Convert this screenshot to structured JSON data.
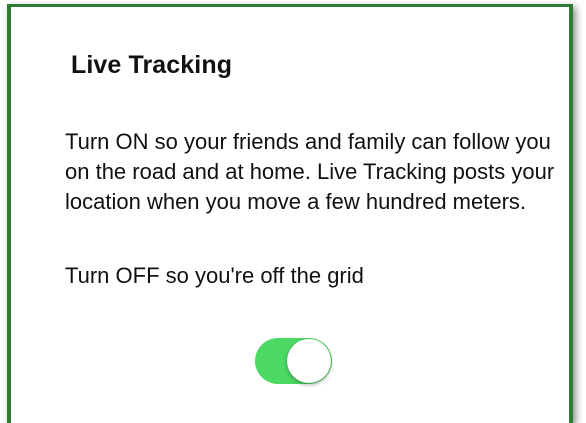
{
  "dialog": {
    "title": "Live Tracking",
    "description_on": "Turn ON so your friends and family can follow you on the road and at home. Live Tracking posts your location when you move a few hundred meters.",
    "description_off": "Turn OFF so you're off the grid",
    "toggle": {
      "state": "on",
      "on_color": "#4cd964"
    },
    "border_color": "#2f7d34"
  }
}
